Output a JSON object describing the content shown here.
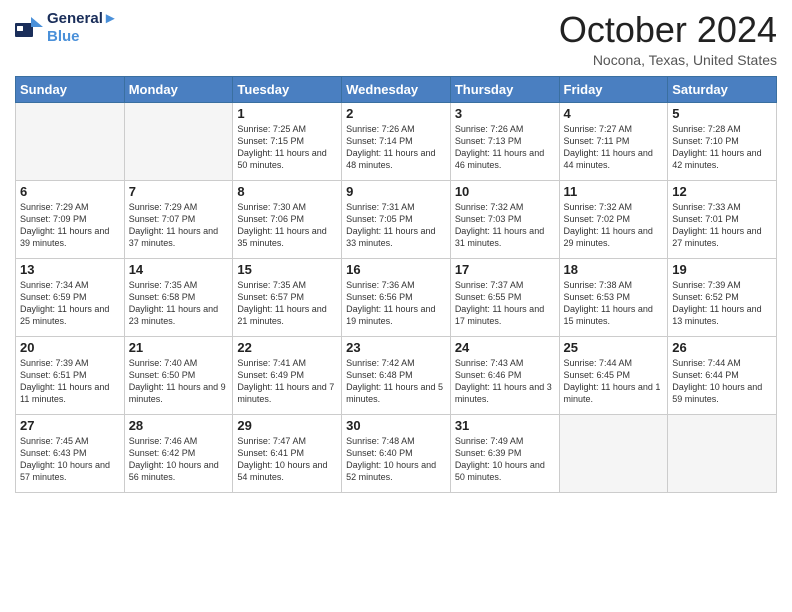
{
  "logo": {
    "line1": "General",
    "line2": "Blue"
  },
  "title": "October 2024",
  "subtitle": "Nocona, Texas, United States",
  "days": [
    "Sunday",
    "Monday",
    "Tuesday",
    "Wednesday",
    "Thursday",
    "Friday",
    "Saturday"
  ],
  "weeks": [
    [
      {
        "day": "",
        "content": ""
      },
      {
        "day": "",
        "content": ""
      },
      {
        "day": "1",
        "content": "Sunrise: 7:25 AM\nSunset: 7:15 PM\nDaylight: 11 hours and 50 minutes."
      },
      {
        "day": "2",
        "content": "Sunrise: 7:26 AM\nSunset: 7:14 PM\nDaylight: 11 hours and 48 minutes."
      },
      {
        "day": "3",
        "content": "Sunrise: 7:26 AM\nSunset: 7:13 PM\nDaylight: 11 hours and 46 minutes."
      },
      {
        "day": "4",
        "content": "Sunrise: 7:27 AM\nSunset: 7:11 PM\nDaylight: 11 hours and 44 minutes."
      },
      {
        "day": "5",
        "content": "Sunrise: 7:28 AM\nSunset: 7:10 PM\nDaylight: 11 hours and 42 minutes."
      }
    ],
    [
      {
        "day": "6",
        "content": "Sunrise: 7:29 AM\nSunset: 7:09 PM\nDaylight: 11 hours and 39 minutes."
      },
      {
        "day": "7",
        "content": "Sunrise: 7:29 AM\nSunset: 7:07 PM\nDaylight: 11 hours and 37 minutes."
      },
      {
        "day": "8",
        "content": "Sunrise: 7:30 AM\nSunset: 7:06 PM\nDaylight: 11 hours and 35 minutes."
      },
      {
        "day": "9",
        "content": "Sunrise: 7:31 AM\nSunset: 7:05 PM\nDaylight: 11 hours and 33 minutes."
      },
      {
        "day": "10",
        "content": "Sunrise: 7:32 AM\nSunset: 7:03 PM\nDaylight: 11 hours and 31 minutes."
      },
      {
        "day": "11",
        "content": "Sunrise: 7:32 AM\nSunset: 7:02 PM\nDaylight: 11 hours and 29 minutes."
      },
      {
        "day": "12",
        "content": "Sunrise: 7:33 AM\nSunset: 7:01 PM\nDaylight: 11 hours and 27 minutes."
      }
    ],
    [
      {
        "day": "13",
        "content": "Sunrise: 7:34 AM\nSunset: 6:59 PM\nDaylight: 11 hours and 25 minutes."
      },
      {
        "day": "14",
        "content": "Sunrise: 7:35 AM\nSunset: 6:58 PM\nDaylight: 11 hours and 23 minutes."
      },
      {
        "day": "15",
        "content": "Sunrise: 7:35 AM\nSunset: 6:57 PM\nDaylight: 11 hours and 21 minutes."
      },
      {
        "day": "16",
        "content": "Sunrise: 7:36 AM\nSunset: 6:56 PM\nDaylight: 11 hours and 19 minutes."
      },
      {
        "day": "17",
        "content": "Sunrise: 7:37 AM\nSunset: 6:55 PM\nDaylight: 11 hours and 17 minutes."
      },
      {
        "day": "18",
        "content": "Sunrise: 7:38 AM\nSunset: 6:53 PM\nDaylight: 11 hours and 15 minutes."
      },
      {
        "day": "19",
        "content": "Sunrise: 7:39 AM\nSunset: 6:52 PM\nDaylight: 11 hours and 13 minutes."
      }
    ],
    [
      {
        "day": "20",
        "content": "Sunrise: 7:39 AM\nSunset: 6:51 PM\nDaylight: 11 hours and 11 minutes."
      },
      {
        "day": "21",
        "content": "Sunrise: 7:40 AM\nSunset: 6:50 PM\nDaylight: 11 hours and 9 minutes."
      },
      {
        "day": "22",
        "content": "Sunrise: 7:41 AM\nSunset: 6:49 PM\nDaylight: 11 hours and 7 minutes."
      },
      {
        "day": "23",
        "content": "Sunrise: 7:42 AM\nSunset: 6:48 PM\nDaylight: 11 hours and 5 minutes."
      },
      {
        "day": "24",
        "content": "Sunrise: 7:43 AM\nSunset: 6:46 PM\nDaylight: 11 hours and 3 minutes."
      },
      {
        "day": "25",
        "content": "Sunrise: 7:44 AM\nSunset: 6:45 PM\nDaylight: 11 hours and 1 minute."
      },
      {
        "day": "26",
        "content": "Sunrise: 7:44 AM\nSunset: 6:44 PM\nDaylight: 10 hours and 59 minutes."
      }
    ],
    [
      {
        "day": "27",
        "content": "Sunrise: 7:45 AM\nSunset: 6:43 PM\nDaylight: 10 hours and 57 minutes."
      },
      {
        "day": "28",
        "content": "Sunrise: 7:46 AM\nSunset: 6:42 PM\nDaylight: 10 hours and 56 minutes."
      },
      {
        "day": "29",
        "content": "Sunrise: 7:47 AM\nSunset: 6:41 PM\nDaylight: 10 hours and 54 minutes."
      },
      {
        "day": "30",
        "content": "Sunrise: 7:48 AM\nSunset: 6:40 PM\nDaylight: 10 hours and 52 minutes."
      },
      {
        "day": "31",
        "content": "Sunrise: 7:49 AM\nSunset: 6:39 PM\nDaylight: 10 hours and 50 minutes."
      },
      {
        "day": "",
        "content": ""
      },
      {
        "day": "",
        "content": ""
      }
    ]
  ]
}
